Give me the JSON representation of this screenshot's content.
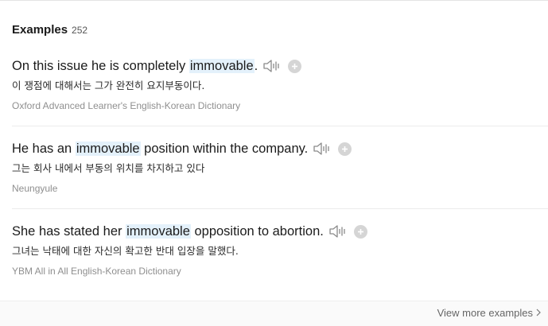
{
  "section": {
    "title": "Examples",
    "count": "252"
  },
  "examples": [
    {
      "pre": "On this issue he is completely ",
      "highlight": "immovable",
      "post": ".",
      "translation": "이 쟁점에 대해서는 그가 완전히 요지부동이다.",
      "source": "Oxford Advanced Learner's English-Korean Dictionary"
    },
    {
      "pre": "He has an ",
      "highlight": "immovable",
      "post": " position within the company.",
      "translation": "그는 회사 내에서 부동의 위치를 차지하고 있다",
      "source": "Neungyule"
    },
    {
      "pre": "She has stated her ",
      "highlight": "immovable",
      "post": " opposition to abortion.",
      "translation": "그녀는 낙태에 대한 자신의 확고한 반대 입장을 말했다.",
      "source": "YBM All in All English-Korean Dictionary"
    }
  ],
  "footer": {
    "view_more": "View more examples"
  },
  "icons": {
    "speaker": "speaker-icon",
    "add": "plus-icon",
    "chevron": "chevron-right-icon"
  },
  "colors": {
    "highlight_bg": "#e4f1fb",
    "source_text": "#8f8f8f",
    "add_button": "#d5d5d5"
  }
}
